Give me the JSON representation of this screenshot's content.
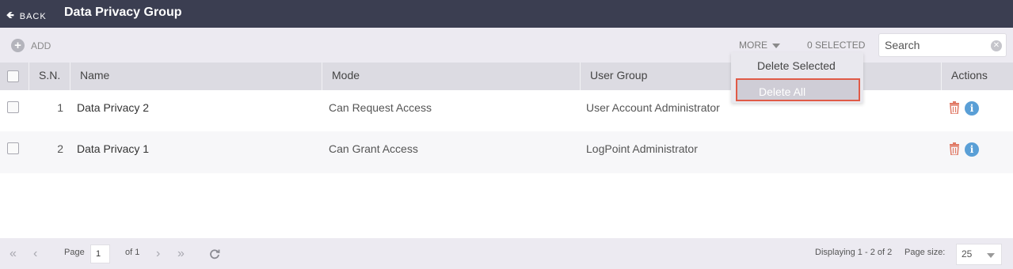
{
  "header": {
    "back_label": "BACK",
    "title": "Data Privacy Group"
  },
  "toolbar": {
    "add_label": "ADD",
    "more_label": "MORE",
    "selected_label": "0 SELECTED",
    "search_placeholder": "Search"
  },
  "table": {
    "columns": [
      "S.N.",
      "Name",
      "Mode",
      "User Group",
      "Actions"
    ],
    "rows": [
      {
        "sn": "1",
        "name": "Data Privacy 2",
        "mode": "Can Request Access",
        "user_group": "User Account Administrator"
      },
      {
        "sn": "2",
        "name": "Data Privacy 1",
        "mode": "Can Grant Access",
        "user_group": "LogPoint Administrator"
      }
    ]
  },
  "dropdown": {
    "items": [
      "Delete Selected",
      "Delete All"
    ],
    "highlighted": "Delete All"
  },
  "footer": {
    "page_label": "Page",
    "page_value": "1",
    "of_label": "of 1",
    "displaying": "Displaying 1 - 2 of 2",
    "page_size_label": "Page size:",
    "page_size_value": "25"
  },
  "colors": {
    "header_bg": "#3b3e51",
    "highlight_border": "#e05a47",
    "trash": "#e07a66",
    "info": "#5a9fd6"
  },
  "icons": [
    "back-arrow-icon",
    "add-circle-icon",
    "caret-down-icon",
    "clear-icon",
    "trash-icon",
    "info-icon",
    "first-page-icon",
    "prev-page-icon",
    "next-page-icon",
    "last-page-icon",
    "refresh-icon"
  ]
}
